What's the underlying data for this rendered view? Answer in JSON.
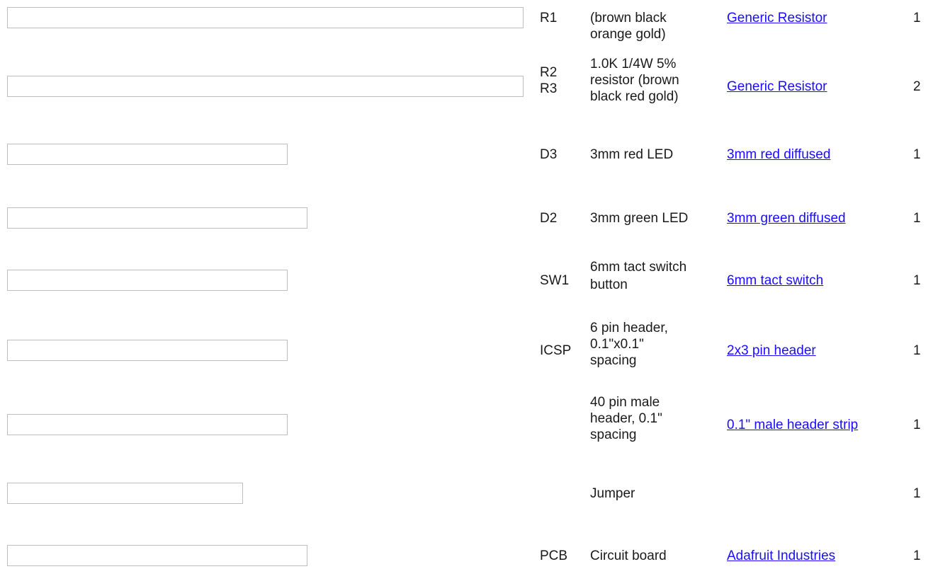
{
  "rows": [
    {
      "ref": [
        "R1"
      ],
      "desc": [
        "(brown black",
        "orange gold)"
      ],
      "part": "Generic Resistor",
      "qty": "1"
    },
    {
      "ref": [
        "R2",
        "R3"
      ],
      "desc": [
        "1.0K 1/4W 5%",
        "resistor (brown",
        "black red gold)"
      ],
      "part": "Generic Resistor",
      "qty": "2"
    },
    {
      "ref": [
        "D3"
      ],
      "desc": [
        "3mm red LED"
      ],
      "part": "3mm red diffused",
      "qty": "1"
    },
    {
      "ref": [
        "D2"
      ],
      "desc": [
        "3mm green LED"
      ],
      "part": "3mm green diffused",
      "qty": "1"
    },
    {
      "ref": [
        "SW1"
      ],
      "desc": [
        "6mm tact switch",
        "button"
      ],
      "part": "6mm tact switch",
      "qty": "1"
    },
    {
      "ref": [
        "ICSP"
      ],
      "desc": [
        "6 pin header,",
        "0.1\"x0.1\"",
        "spacing"
      ],
      "part": "2x3 pin header",
      "qty": "1"
    },
    {
      "ref": [],
      "desc": [
        "40 pin male",
        "header, 0.1\"",
        "spacing"
      ],
      "part": "0.1\" male header strip",
      "qty": "1"
    },
    {
      "ref": [],
      "desc": [
        "Jumper"
      ],
      "part": "",
      "qty": "1"
    },
    {
      "ref": [
        "PCB"
      ],
      "desc": [
        "Circuit board"
      ],
      "part": "Adafruit Industries",
      "qty": "1"
    }
  ],
  "colors": {
    "link": "#1a0dff",
    "text": "#1a1a1a",
    "image_border": "#bdbdbd"
  }
}
